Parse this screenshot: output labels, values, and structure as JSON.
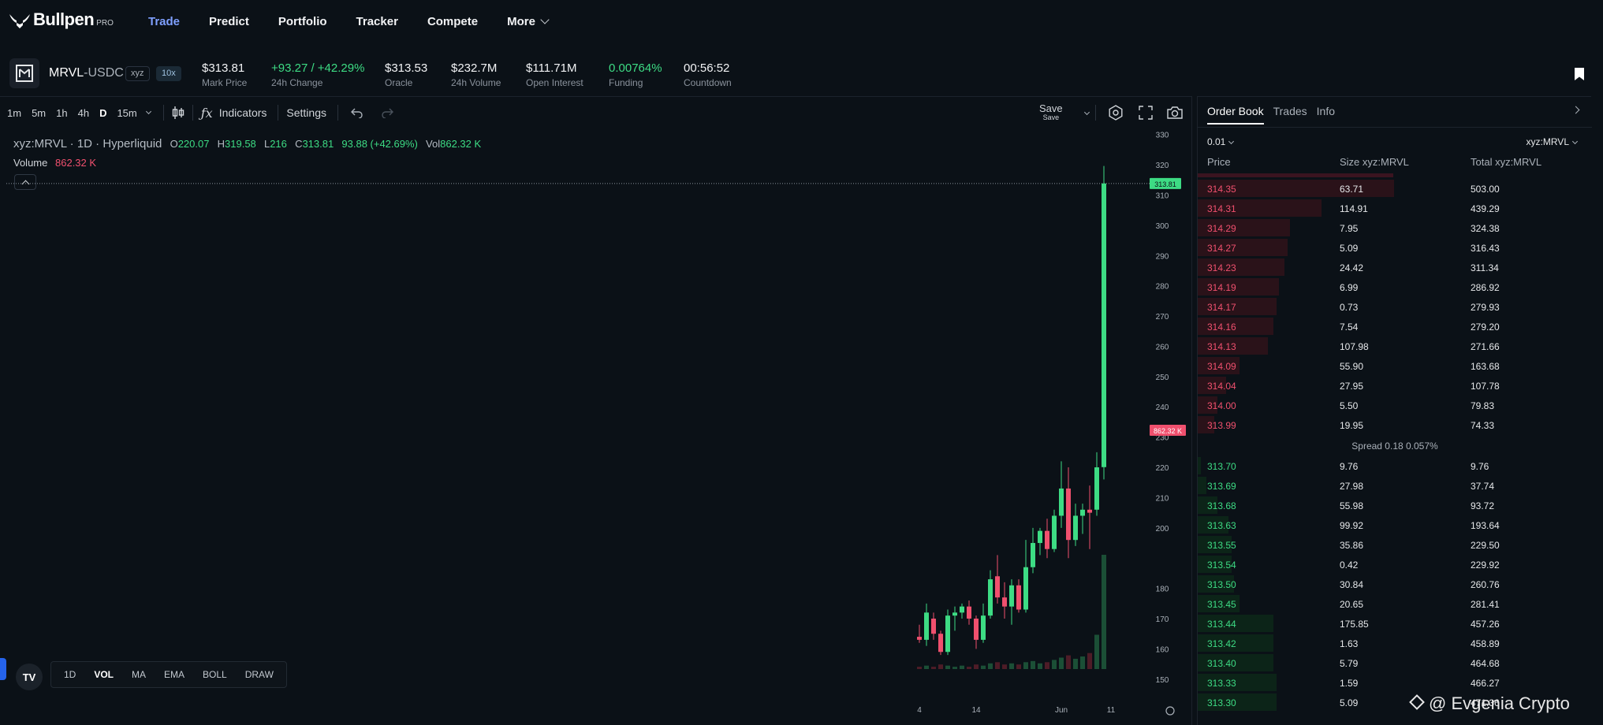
{
  "brand": {
    "name": "Bullpen",
    "tier": "PRO"
  },
  "nav": [
    {
      "label": "Trade",
      "active": true
    },
    {
      "label": "Predict"
    },
    {
      "label": "Portfolio"
    },
    {
      "label": "Tracker"
    },
    {
      "label": "Compete"
    },
    {
      "label": "More"
    }
  ],
  "ticker": {
    "base": "MRVL",
    "quote": "-USDC",
    "tag": "xyz",
    "leverage": "10x",
    "stats": [
      {
        "value": "$313.81",
        "label": "Mark Price"
      },
      {
        "value": "+93.27 / +42.29%",
        "label": "24h Change",
        "color": "green"
      },
      {
        "value": "$313.53",
        "label": "Oracle"
      },
      {
        "value": "$232.7M",
        "label": "24h Volume"
      },
      {
        "value": "$111.71M",
        "label": "Open Interest"
      },
      {
        "value": "0.00764%",
        "label": "Funding",
        "color": "green"
      },
      {
        "value": "00:56:52",
        "label": "Countdown"
      }
    ]
  },
  "toolbar": {
    "timeframes": [
      "1m",
      "5m",
      "1h",
      "4h",
      "D",
      "15m"
    ],
    "active_timeframe": "D",
    "indicators_label": "Indicators",
    "settings_label": "Settings",
    "save_label": "Save",
    "save_sub": "Save"
  },
  "legend": {
    "symbol": "xyz:MRVL · 1D · Hyperliquid",
    "o_key": "O",
    "o": "220.07",
    "h_key": "H",
    "h": "319.58",
    "l_key": "L",
    "l": "216",
    "c_key": "C",
    "c": "313.81",
    "change": "93.88 (+42.69%)",
    "vol_key": "Vol",
    "vol": "862.32 K",
    "volume_label": "Volume",
    "volume_value": "862.32 K"
  },
  "chart_data": {
    "type": "candlestick",
    "y_ticks": [
      330,
      320,
      310,
      300,
      290,
      280,
      270,
      260,
      250,
      240,
      230,
      220,
      210,
      200,
      180,
      170,
      160,
      150
    ],
    "ylim": [
      145,
      332
    ],
    "x_ticks": [
      {
        "label": "4",
        "index": 0
      },
      {
        "label": "14",
        "index": 8
      },
      {
        "label": "Jun",
        "index": 20
      },
      {
        "label": "11",
        "index": 27
      }
    ],
    "last_price_label": "313.81",
    "last_volume_label": "862.32 K",
    "candles": [
      {
        "o": 164,
        "h": 168,
        "l": 162,
        "c": 163
      },
      {
        "o": 163,
        "h": 175,
        "l": 161,
        "c": 172
      },
      {
        "o": 170,
        "h": 172,
        "l": 163,
        "c": 165
      },
      {
        "o": 165,
        "h": 166,
        "l": 158,
        "c": 159
      },
      {
        "o": 159,
        "h": 173,
        "l": 158,
        "c": 171
      },
      {
        "o": 171,
        "h": 174,
        "l": 166,
        "c": 172
      },
      {
        "o": 172,
        "h": 175,
        "l": 170,
        "c": 174
      },
      {
        "o": 174,
        "h": 176,
        "l": 168,
        "c": 170
      },
      {
        "o": 170,
        "h": 171,
        "l": 160,
        "c": 163
      },
      {
        "o": 163,
        "h": 175,
        "l": 162,
        "c": 171
      },
      {
        "o": 171,
        "h": 186,
        "l": 170,
        "c": 183
      },
      {
        "o": 184,
        "h": 191,
        "l": 175,
        "c": 177
      },
      {
        "o": 177,
        "h": 182,
        "l": 170,
        "c": 174
      },
      {
        "o": 174,
        "h": 183,
        "l": 168,
        "c": 181
      },
      {
        "o": 181,
        "h": 183,
        "l": 172,
        "c": 173
      },
      {
        "o": 173,
        "h": 196,
        "l": 172,
        "c": 187
      },
      {
        "o": 187,
        "h": 200,
        "l": 185,
        "c": 195
      },
      {
        "o": 195,
        "h": 200,
        "l": 191,
        "c": 199
      },
      {
        "o": 199,
        "h": 203,
        "l": 190,
        "c": 193
      },
      {
        "o": 193,
        "h": 206,
        "l": 192,
        "c": 204
      },
      {
        "o": 204,
        "h": 222,
        "l": 200,
        "c": 213
      },
      {
        "o": 213,
        "h": 220,
        "l": 190,
        "c": 196
      },
      {
        "o": 196,
        "h": 208,
        "l": 194,
        "c": 204
      },
      {
        "o": 204,
        "h": 208,
        "l": 198,
        "c": 206
      },
      {
        "o": 206,
        "h": 214,
        "l": 193,
        "c": 205
      },
      {
        "o": 206,
        "h": 225,
        "l": 204,
        "c": 220
      },
      {
        "o": 220.07,
        "h": 319.58,
        "l": 216,
        "c": 313.81
      }
    ],
    "volumes": [
      2,
      3,
      2,
      4,
      3,
      2,
      3,
      2,
      4,
      3,
      5,
      6,
      4,
      5,
      4,
      6,
      7,
      5,
      6,
      8,
      10,
      12,
      9,
      11,
      14,
      30,
      100
    ]
  },
  "bottom_tabs": [
    "1D",
    "VOL",
    "MA",
    "EMA",
    "BOLL",
    "DRAW"
  ],
  "bottom_active": "VOL",
  "tv_logo": "TV",
  "orderbook": {
    "tabs": [
      "Order Book",
      "Trades",
      "Info"
    ],
    "tick_size": "0.01",
    "market": "xyz:MRVL",
    "headers": {
      "price": "Price",
      "size": "Size xyz:MRVL",
      "total": "Total xyz:MRVL"
    },
    "asks": [
      {
        "price": "314.35",
        "size": "63.71",
        "total": "503.00",
        "depth": 0.7
      },
      {
        "price": "314.31",
        "size": "114.91",
        "total": "439.29",
        "depth": 0.44
      },
      {
        "price": "314.29",
        "size": "7.95",
        "total": "324.38",
        "depth": 0.33
      },
      {
        "price": "314.27",
        "size": "5.09",
        "total": "316.43",
        "depth": 0.32
      },
      {
        "price": "314.23",
        "size": "24.42",
        "total": "311.34",
        "depth": 0.31
      },
      {
        "price": "314.19",
        "size": "6.99",
        "total": "286.92",
        "depth": 0.29
      },
      {
        "price": "314.17",
        "size": "0.73",
        "total": "279.93",
        "depth": 0.28
      },
      {
        "price": "314.16",
        "size": "7.54",
        "total": "279.20",
        "depth": 0.27
      },
      {
        "price": "314.13",
        "size": "107.98",
        "total": "271.66",
        "depth": 0.25
      },
      {
        "price": "314.09",
        "size": "55.90",
        "total": "163.68",
        "depth": 0.15
      },
      {
        "price": "314.04",
        "size": "27.95",
        "total": "107.78",
        "depth": 0.1
      },
      {
        "price": "314.00",
        "size": "5.50",
        "total": "79.83",
        "depth": 0.07
      },
      {
        "price": "313.99",
        "size": "19.95",
        "total": "74.33",
        "depth": 0.06
      }
    ],
    "spread": "Spread 0.18 0.057%",
    "bids": [
      {
        "price": "313.70",
        "size": "9.76",
        "total": "9.76",
        "depth": 0.01
      },
      {
        "price": "313.69",
        "size": "27.98",
        "total": "37.74",
        "depth": 0.03
      },
      {
        "price": "313.68",
        "size": "55.98",
        "total": "93.72",
        "depth": 0.07
      },
      {
        "price": "313.63",
        "size": "99.92",
        "total": "193.64",
        "depth": 0.11
      },
      {
        "price": "313.55",
        "size": "35.86",
        "total": "229.50",
        "depth": 0.12
      },
      {
        "price": "313.54",
        "size": "0.42",
        "total": "229.92",
        "depth": 0.12
      },
      {
        "price": "313.50",
        "size": "30.84",
        "total": "260.76",
        "depth": 0.13
      },
      {
        "price": "313.45",
        "size": "20.65",
        "total": "281.41",
        "depth": 0.15
      },
      {
        "price": "313.44",
        "size": "175.85",
        "total": "457.26",
        "depth": 0.27
      },
      {
        "price": "313.42",
        "size": "1.63",
        "total": "458.89",
        "depth": 0.27
      },
      {
        "price": "313.40",
        "size": "5.79",
        "total": "464.68",
        "depth": 0.27
      },
      {
        "price": "313.33",
        "size": "1.59",
        "total": "466.27",
        "depth": 0.28
      },
      {
        "price": "313.30",
        "size": "5.09",
        "total": "471.36",
        "depth": 0.28
      }
    ]
  },
  "watermark": "@ Evgenia Crypto",
  "colors": {
    "accent": "#7fa0ff",
    "up": "#3ddc84",
    "down": "#f0506e",
    "bg": "#0b1117"
  }
}
